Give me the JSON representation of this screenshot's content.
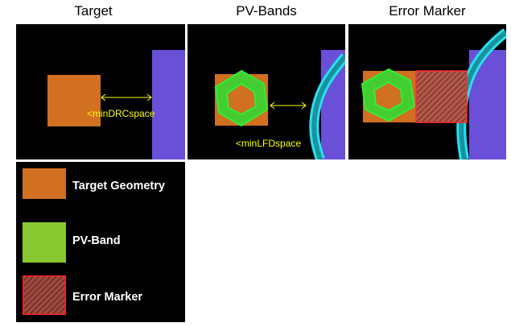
{
  "titles": {
    "target": "Target",
    "pv_bands": "PV-Bands",
    "error_marker": "Error Marker"
  },
  "annotations": {
    "min_drc_space": "<minDRCspace",
    "min_lfd_space": "<minLFDspace"
  },
  "legend": {
    "items": [
      {
        "label": "Target Geometry",
        "color": "#d07020"
      },
      {
        "label": "PV-Band",
        "color": "#88c830"
      },
      {
        "label": "Error Marker",
        "color": "#ff2020"
      }
    ]
  },
  "colors": {
    "target_geometry": "#d07020",
    "pv_band": "#33ee33",
    "neighbor_shape": "#6a4fd8",
    "pv_band_cyan": "#28e0f0",
    "error_marker": "#ff2a2a",
    "arrow": "#ffff00"
  }
}
